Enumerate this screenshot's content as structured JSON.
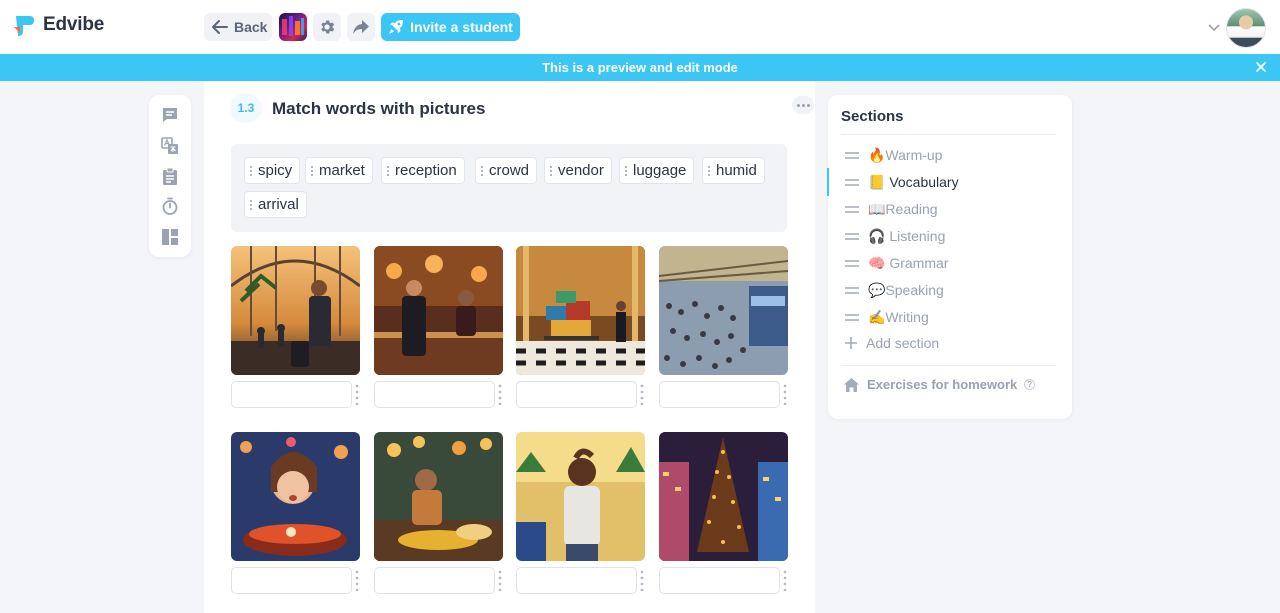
{
  "app": {
    "name": "Edvibe"
  },
  "toolbar": {
    "back_label": "Back",
    "invite_label": "Invite a student",
    "icons": [
      "arrow-left-icon",
      "gear-icon",
      "share-arrow-icon",
      "rocket-icon"
    ]
  },
  "banner": {
    "text": "This is a preview and edit mode"
  },
  "tools": [
    "chat-icon",
    "translate-icon",
    "clipboard-icon",
    "timer-icon",
    "layout-icon"
  ],
  "exercise": {
    "number": "1.3",
    "title": "Match words with pictures",
    "words": [
      "spicy",
      "market",
      "reception",
      "crowd",
      "vendor",
      "luggage",
      "humid",
      "arrival"
    ],
    "pictures": [
      {
        "subject": "airport traveller with luggage",
        "answer": ""
      },
      {
        "subject": "hotel reception desk",
        "answer": ""
      },
      {
        "subject": "luggage cart in hotel lobby",
        "answer": ""
      },
      {
        "subject": "crowd at train station",
        "answer": ""
      },
      {
        "subject": "woman eating spicy soup",
        "answer": ""
      },
      {
        "subject": "street food vendor",
        "answer": ""
      },
      {
        "subject": "sweating man in humid street",
        "answer": ""
      },
      {
        "subject": "busy night market",
        "answer": ""
      }
    ]
  },
  "sections": {
    "title": "Sections",
    "items": [
      {
        "label": "🔥Warm-up",
        "active": false
      },
      {
        "label": "📒 Vocabulary",
        "active": true
      },
      {
        "label": "📖Reading",
        "active": false
      },
      {
        "label": "🎧 Listening",
        "active": false
      },
      {
        "label": "🧠 Grammar",
        "active": false
      },
      {
        "label": "💬Speaking",
        "active": false
      },
      {
        "label": "✍️Writing",
        "active": false
      }
    ],
    "add_label": "Add section",
    "homework_label": "Exercises for homework",
    "help_mark": "?"
  },
  "colors": {
    "accent": "#3cc6f4",
    "text": "#2b3444",
    "muted": "#9aa2b0",
    "page_bg": "#f3f5f9"
  }
}
